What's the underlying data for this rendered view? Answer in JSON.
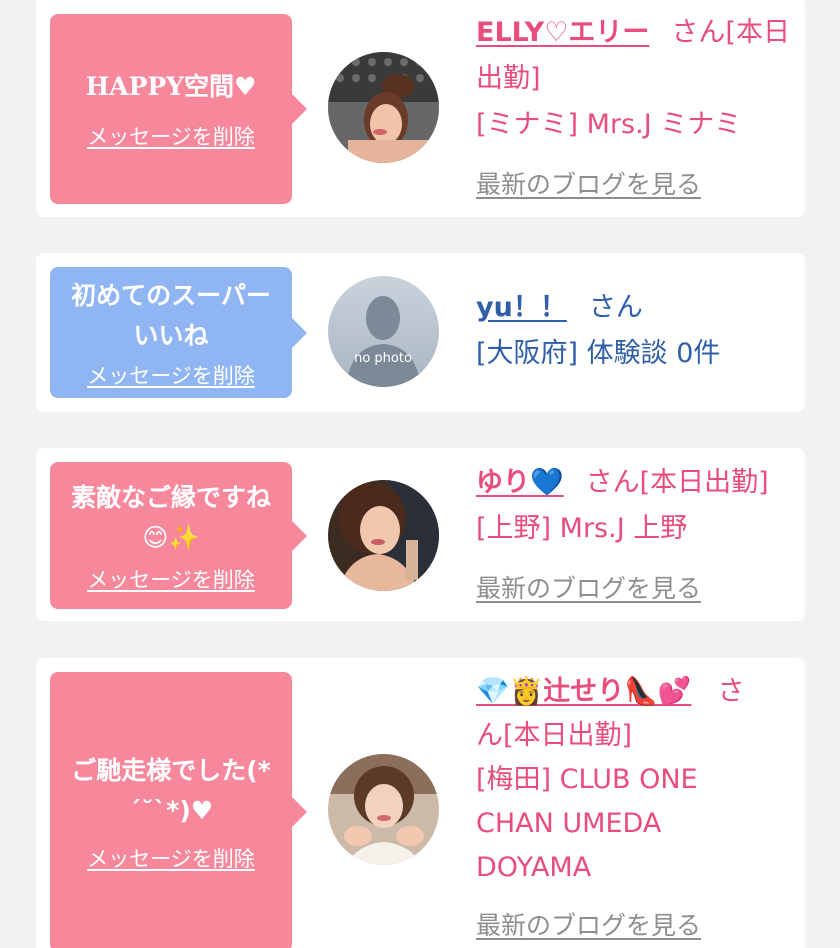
{
  "delete_label": "メッセージを削除",
  "blog_label": "最新のブログを見る",
  "cards": [
    {
      "message": "HAPPY空間♥",
      "name": "ELLY♡エリー",
      "suffix": "さん[本日出勤]",
      "store": "[ミナミ] Mrs.J ミナミ",
      "color": "#f7889c"
    },
    {
      "message_lines": [
        "初めてのスーパー",
        "いいね"
      ],
      "name": "yu！！",
      "suffix": "さん",
      "store": "[大阪府] 体験談 0件",
      "avatar_text": "no photo",
      "color": "#8fb6f3"
    },
    {
      "message_lines": [
        "素敵なご縁ですね",
        "😊✨"
      ],
      "name": "ゆり💙",
      "suffix": "さん[本日出勤]",
      "store": "[上野] Mrs.J 上野",
      "color": "#f7889c"
    },
    {
      "message_lines": [
        "ご馳走様でした(*",
        "´˘`*)♥"
      ],
      "name": "💎👸辻せり👠💕",
      "suffix_lines": [
        "さ",
        "ん[本日出勤]"
      ],
      "store_lines": [
        "[梅田] CLUB ONE",
        "CHAN UMEDA",
        "DOYAMA"
      ],
      "color": "#f7889c"
    }
  ]
}
